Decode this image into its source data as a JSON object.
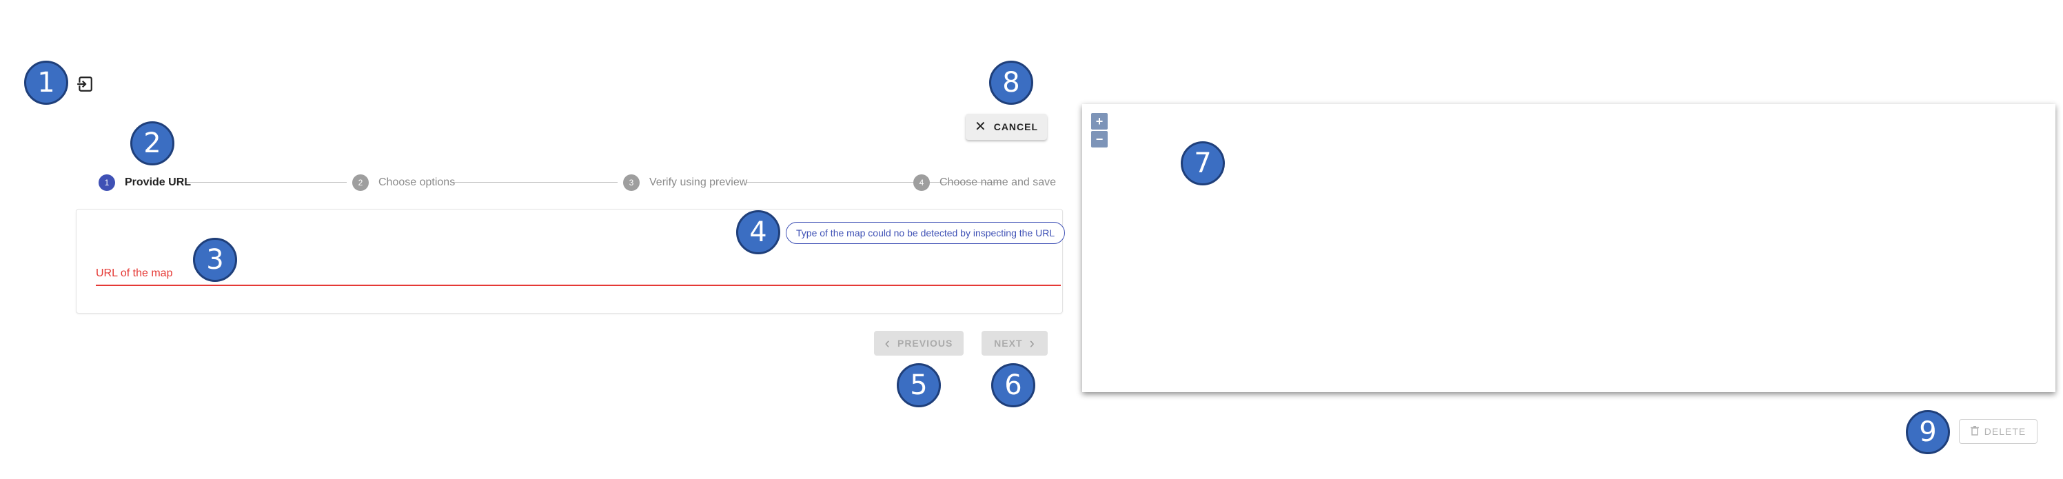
{
  "toolbar": {
    "cancel_label": "CANCEL"
  },
  "stepper": {
    "steps": [
      {
        "number": "1",
        "label": "Provide URL",
        "active": true
      },
      {
        "number": "2",
        "label": "Choose options",
        "active": false
      },
      {
        "number": "3",
        "label": "Verify using preview",
        "active": false
      },
      {
        "number": "4",
        "label": "Choose name and save",
        "active": false
      }
    ]
  },
  "form": {
    "detection_chip": "Type of the map could no be detected by inspecting the URL",
    "url_field_label": "URL of the map"
  },
  "navigation": {
    "previous_label": "PREVIOUS",
    "next_label": "NEXT"
  },
  "map": {
    "zoom_in": "+",
    "zoom_out": "−"
  },
  "footer": {
    "delete_label": "DELETE"
  },
  "callouts": [
    "1",
    "2",
    "3",
    "4",
    "5",
    "6",
    "7",
    "8",
    "9"
  ],
  "colors": {
    "primary": "#3f51b5",
    "error": "#e53935",
    "callout_fill": "#3b6ec2",
    "disabled_bg": "#e0e0e0"
  },
  "icons": {
    "exit": "exit-to-app-icon",
    "cancel": "close-icon",
    "previous": "chevron-left-icon",
    "next": "chevron-right-icon",
    "delete": "trash-icon"
  }
}
